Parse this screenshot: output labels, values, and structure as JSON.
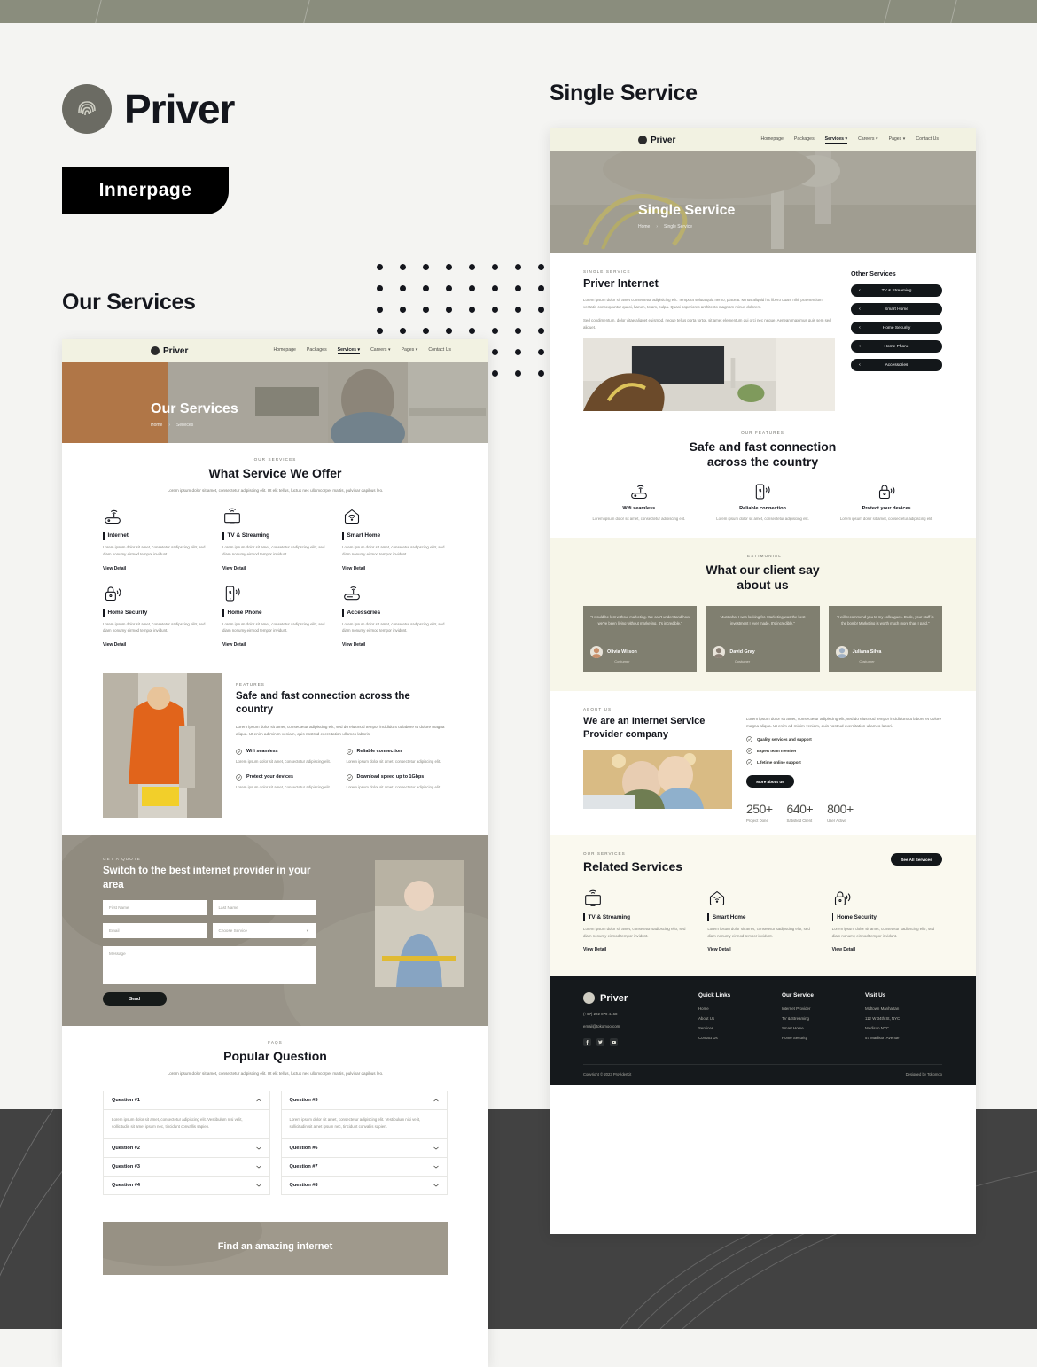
{
  "brand": {
    "name": "Priver",
    "badge": "Innerpage"
  },
  "labels": {
    "our_services": "Our Services",
    "single_service": "Single Service"
  },
  "nav": {
    "logo": "Priver",
    "items": [
      {
        "label": "Homepage",
        "active": false
      },
      {
        "label": "Packages",
        "active": false
      },
      {
        "label": "Services ▾",
        "active": true
      },
      {
        "label": "Careers ▾",
        "active": false
      },
      {
        "label": "Pages ▾",
        "active": false
      },
      {
        "label": "Contact Us",
        "active": false
      }
    ]
  },
  "services_page": {
    "hero": {
      "title": "Our Services",
      "crumb_home": "Home",
      "crumb_sep": "›",
      "crumb_current": "Services"
    },
    "offer": {
      "eyebrow": "OUR SERVICES",
      "title": "What Service We Offer",
      "lead": "Lorem ipsum dolor sit amet, consectetur adipiscing elit. Ut elit tellus, luctus nec ullamcorper mattis, pulvinar dapibus leo.",
      "cards": [
        {
          "icon": "wifi-router-icon",
          "title": "Internet",
          "desc": "Lorem ipsum dolor sit amet, consetetur sadipscing elitr, sed diam nonumy eirmod tempor invidunt.",
          "link": "View Detail"
        },
        {
          "icon": "tv-streaming-icon",
          "title": "TV & Streaming",
          "desc": "Lorem ipsum dolor sit amet, consetetur sadipscing elitr, sed diam nonumy eirmod tempor invidunt.",
          "link": "View Detail"
        },
        {
          "icon": "smart-home-icon",
          "title": "Smart Home",
          "desc": "Lorem ipsum dolor sit amet, consetetur sadipscing elitr, sed diam nonumy eirmod tempor invidunt.",
          "link": "View Detail"
        },
        {
          "icon": "home-security-icon",
          "title": "Home Security",
          "desc": "Lorem ipsum dolor sit amet, consetetur sadipscing elitr, sed diam nonumy eirmod tempor invidunt.",
          "link": "View Detail"
        },
        {
          "icon": "home-phone-icon",
          "title": "Home Phone",
          "desc": "Lorem ipsum dolor sit amet, consetetur sadipscing elitr, sed diam nonumy eirmod tempor invidunt.",
          "link": "View Detail"
        },
        {
          "icon": "accessories-icon",
          "title": "Accessories",
          "desc": "Lorem ipsum dolor sit amet, consetetur sadipscing elitr, sed diam nonumy eirmod tempor invidunt.",
          "link": "View Detail"
        }
      ]
    },
    "features": {
      "eyebrow": "FEATURES",
      "title": "Safe and fast connection across the country",
      "lead": "Lorem ipsum dolor sit amet, consectetur adipiscing elit, sed do eiusmod tempor incididunt ut labore et dolore magna aliqua. Ut enim ad minim veniam, quis nostrud exercitation ullamco laboris.",
      "items": [
        {
          "name": "Wifi seamless",
          "desc": "Lorem ipsum dolor sit amet, consectetur adipiscing elit."
        },
        {
          "name": "Reliable connection",
          "desc": "Lorem ipsum dolor sit amet, consectetur adipiscing elit."
        },
        {
          "name": "Protect your devices",
          "desc": "Lorem ipsum dolor sit amet, consectetur adipiscing elit."
        },
        {
          "name": "Download speed up to 1Gbps",
          "desc": "Lorem ipsum dolor sit amet, consectetur adipiscing elit."
        }
      ]
    },
    "quote": {
      "eyebrow": "GET A QUOTE",
      "title": "Switch to the best internet provider in your area",
      "first_name_placeholder": "First Name",
      "last_name_placeholder": "Last Name",
      "email_placeholder": "Email",
      "service_placeholder": "Choose Service",
      "message_placeholder": "Message",
      "submit_label": "Send"
    },
    "faq": {
      "eyebrow": "FAQS",
      "title": "Popular Question",
      "lead": "Lorem ipsum dolor sit amet, consectetur adipiscing elit. Ut elit tellus, luctus nec ullamcorper mattis, pulvinar dapibus leo.",
      "answer": "Lorem ipsum dolor sit amet, consectetur adipiscing elit. Vestibulum nisi velit, sollicitudin sit amet ipsum nec, tincidunt convallis sapien.",
      "left": [
        {
          "q": "Question #1",
          "open": true
        },
        {
          "q": "Question #2",
          "open": false
        },
        {
          "q": "Question #3",
          "open": false
        },
        {
          "q": "Question #4",
          "open": false
        }
      ],
      "right": [
        {
          "q": "Question #5",
          "open": true
        },
        {
          "q": "Question #6",
          "open": false
        },
        {
          "q": "Question #7",
          "open": false
        },
        {
          "q": "Question #8",
          "open": false
        }
      ]
    },
    "cta": {
      "title": "Find an amazing internet"
    }
  },
  "single_page": {
    "hero": {
      "title": "Single Service",
      "crumb_home": "Home",
      "crumb_sep": "›",
      "crumb_current": "Single Service"
    },
    "detail": {
      "eyebrow": "SINGLE SERVICE",
      "title": "Priver Internet",
      "paragraph1": "Lorem ipsum dolor sit amet consectetur adipisicing elit. Tempora soluta quia nemo, placeat. Minus aliquid hic libero quam nihil praesentium veritatis consequuntur quasi, harum, totam, culpa. Quasi asperiores architecto magnam minus dolorem.",
      "paragraph2": "Sed condimentum, dolor vitae aliquet euismod, neque tellus porta tortor, sit amet elementum dui orci nec neque. Aenean maximus quis sem sed aliquet."
    },
    "sidebar": {
      "title": "Other Services",
      "items": [
        {
          "label": "TV & Streaming"
        },
        {
          "label": "Smart Home"
        },
        {
          "label": "Home Security"
        },
        {
          "label": "Home Phone"
        },
        {
          "label": "Accessories"
        }
      ]
    },
    "features": {
      "eyebrow": "OUR FEATURES",
      "title_line1": "Safe and fast connection",
      "title_line2": "across the country",
      "items": [
        {
          "icon": "wifi-router-icon",
          "name": "Wifi seamless",
          "desc": "Lorem ipsum dolor sit amet, consectetur adipiscing elit."
        },
        {
          "icon": "home-phone-icon",
          "name": "Reliable connection",
          "desc": "Lorem ipsum dolor sit amet, consectetur adipiscing elit."
        },
        {
          "icon": "lock-wifi-icon",
          "name": "Protect your devices",
          "desc": "Lorem ipsum dolor sit amet, consectetur adipiscing elit."
        }
      ]
    },
    "testimonial": {
      "eyebrow": "TESTIMONIAL",
      "title_line1": "What our client say",
      "title_line2": "about us",
      "cards": [
        {
          "quote": "\"I would be lost without marketing. We can't understand how we've been living without marketing. It's incredible.\"",
          "name": "Olivia Wilson",
          "role": "Costumer"
        },
        {
          "quote": "\"Just what I was looking for. Marketing was the best investment I ever made. It's incredible.\"",
          "name": "David Gray",
          "role": "Costumer"
        },
        {
          "quote": "\"I will recommend you to my colleagues. Dude, your stuff is the bomb! Marketing is worth much more than I paid.\"",
          "name": "Juliana Silva",
          "role": "Costumer"
        }
      ]
    },
    "about": {
      "eyebrow": "ABOUT US",
      "title": "We are an Internet Service Provider company",
      "lead": "Lorem ipsum dolor sit amet, consectetur adipiscing elit, sed do eiusmod tempor incididunt ut labore et dolore magna aliqua. Ut enim ad minim veniam, quis nostrud exercitation ullamco labori.",
      "checks": [
        "Quality services and support",
        "Expert team member",
        "Lifetime online support"
      ],
      "button": "More about us",
      "stats": [
        {
          "value": "250+",
          "label": "Project Done"
        },
        {
          "value": "640+",
          "label": "Satisfied Client"
        },
        {
          "value": "800+",
          "label": "User Active"
        }
      ]
    },
    "related": {
      "eyebrow": "OUR SERVICES",
      "title": "Related Services",
      "button": "See All Services",
      "cards": [
        {
          "icon": "tv-streaming-icon",
          "title": "TV & Streaming",
          "desc": "Lorem ipsum dolor sit amet, consetetur sadipscing elitr, sed diam nonumy eirmod tempor invidunt.",
          "link": "View Detail"
        },
        {
          "icon": "smart-home-icon",
          "title": "Smart Home",
          "desc": "Lorem ipsum dolor sit amet, consetetur sadipscing elitr, sed diam nonumy eirmod tempor invidunt.",
          "link": "View Detail"
        },
        {
          "icon": "home-security-icon",
          "title": "Home Security",
          "desc": "Lorem ipsum dolor sit amet, consetetur sadipscing elitr, sed diam nonumy eirmod tempor invidunt.",
          "link": "View Detail"
        }
      ]
    },
    "footer": {
      "brand": "Priver",
      "phone": "(+67) 222 879 4468",
      "email": "email@tokomoo.com",
      "socials": [
        "facebook-icon",
        "twitter-icon",
        "youtube-icon"
      ],
      "quick_links": {
        "title": "Quick Links",
        "items": [
          "Home",
          "About Us",
          "Services",
          "Contact Us"
        ]
      },
      "our_service": {
        "title": "Our Service",
        "items": [
          "Internet Provider",
          "TV & Streaming",
          "Smart Home",
          "Home Security"
        ]
      },
      "visit_us": {
        "title": "Visit Us",
        "items": [
          "Midtown Manhattan",
          "112 W 34th St, NYC",
          "Madison NYC",
          "57 Madison Avenue"
        ]
      },
      "copyright": "Copyright © 2023 ProviderKit",
      "designed": "Designed by Tokomoo"
    }
  },
  "colors": {
    "band_top": "#8a8d7d",
    "band_bottom": "#424242",
    "nav_bg": "#f2f2e2",
    "dark": "#13171a",
    "cream": "#faf9ef"
  }
}
